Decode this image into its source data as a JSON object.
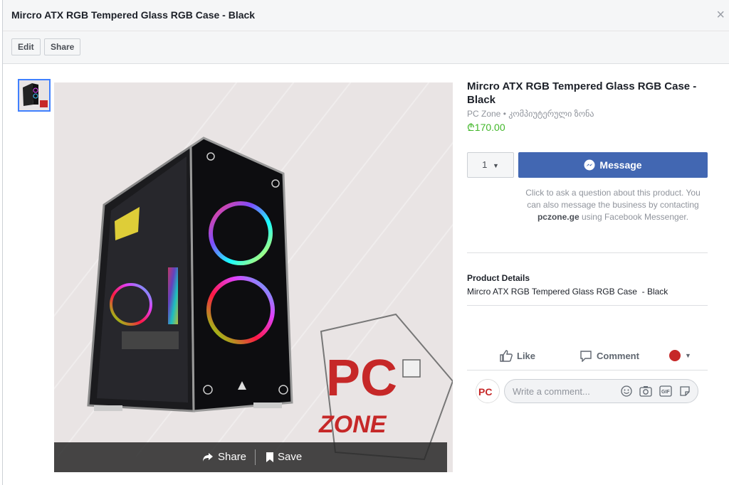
{
  "dialog": {
    "title": "Mircro ATX RGB Tempered Glass RGB Case - Black",
    "close_icon": "close-icon"
  },
  "toolbar": {
    "edit_label": "Edit",
    "share_label": "Share"
  },
  "photo": {
    "share_label": "Share",
    "save_label": "Save",
    "logo_text": "PC ZONE"
  },
  "product": {
    "title": "Mircro ATX RGB Tempered Glass RGB Case - Black",
    "seller": "PC Zone • კომპიუტერული ზონა",
    "price": "₾170.00",
    "quantity": "1",
    "message_label": "Message",
    "help_text_prefix": "Click to ask a question about this product. You can also message the business by contacting ",
    "help_text_link": "pczone.ge",
    "help_text_suffix": " using Facebook Messenger.",
    "details_heading": "Product Details",
    "details_text": "Mircro ATX RGB Tempered Glass RGB Case  - Black"
  },
  "reactions": {
    "like_label": "Like",
    "comment_label": "Comment"
  },
  "comment": {
    "placeholder": "Write a comment..."
  },
  "colors": {
    "accent": "#4267b2",
    "price": "#42b72a"
  }
}
